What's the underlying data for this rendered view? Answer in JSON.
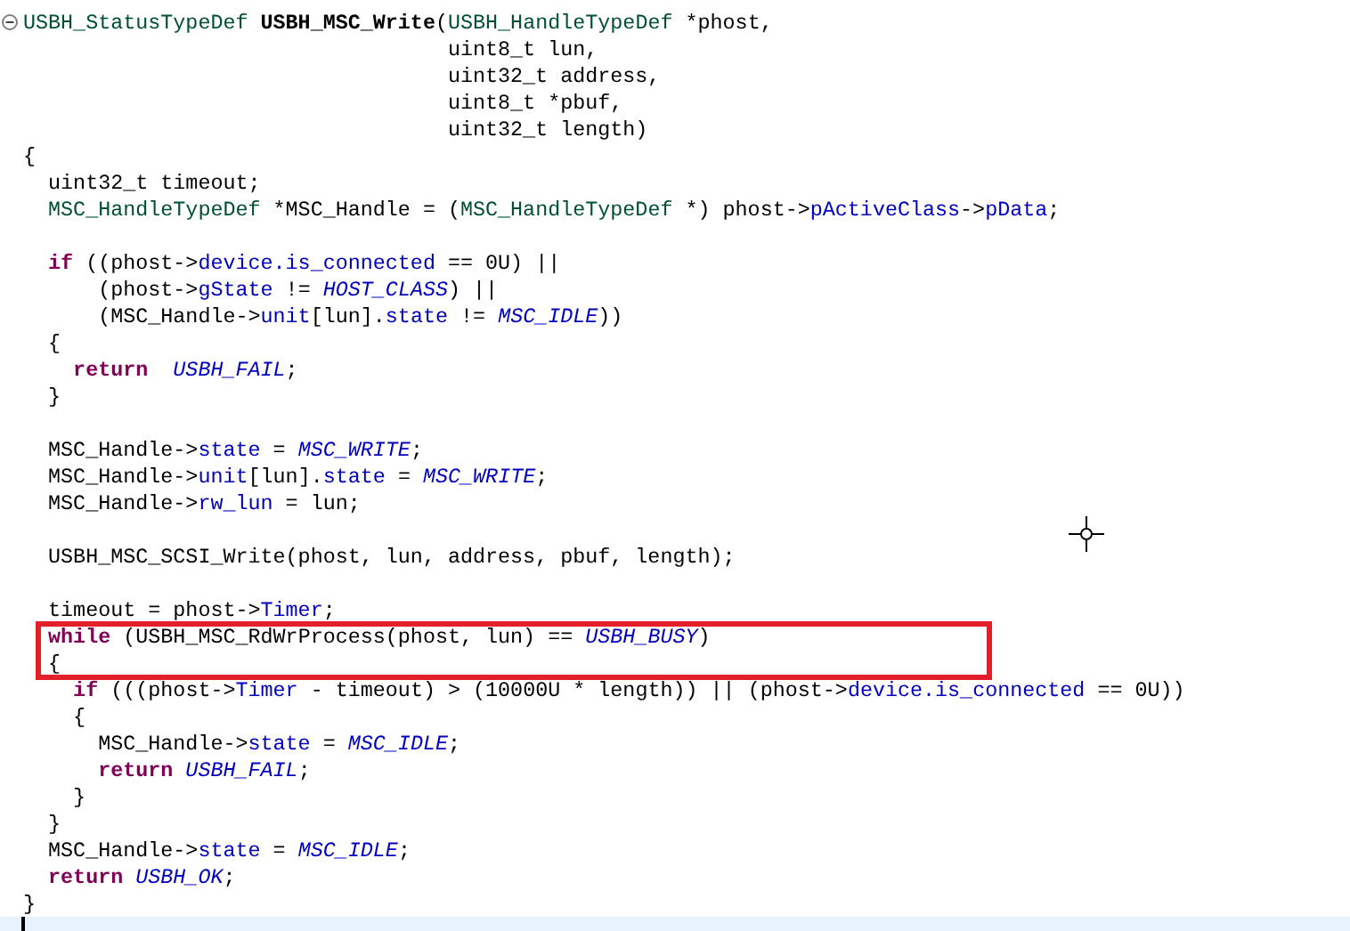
{
  "editor": {
    "lines": [
      {
        "kind": "code",
        "expanded": true,
        "tokens": [
          {
            "text": "USBH_StatusTypeDef ",
            "kind": "type"
          },
          {
            "text": "USBH_MSC_Write",
            "kind": "function"
          },
          {
            "text": "(",
            "kind": "plain"
          },
          {
            "text": "USBH_HandleTypeDef",
            "kind": "type"
          },
          {
            "text": " *phost,",
            "kind": "plain"
          }
        ]
      },
      {
        "kind": "code",
        "tokens": [
          {
            "text": "                                  uint8_t lun,",
            "kind": "plain"
          }
        ]
      },
      {
        "kind": "code",
        "tokens": [
          {
            "text": "                                  uint32_t address,",
            "kind": "plain"
          }
        ]
      },
      {
        "kind": "code",
        "tokens": [
          {
            "text": "                                  uint8_t *pbuf,",
            "kind": "plain"
          }
        ]
      },
      {
        "kind": "code",
        "tokens": [
          {
            "text": "                                  uint32_t length)",
            "kind": "plain"
          }
        ]
      },
      {
        "kind": "code",
        "tokens": [
          {
            "text": "{",
            "kind": "plain"
          }
        ]
      },
      {
        "kind": "code",
        "tokens": [
          {
            "text": "  uint32_t timeout;",
            "kind": "plain"
          }
        ]
      },
      {
        "kind": "code",
        "tokens": [
          {
            "text": "  MSC_HandleTypeDef",
            "kind": "type"
          },
          {
            "text": " *MSC_Handle = (",
            "kind": "plain"
          },
          {
            "text": "MSC_HandleTypeDef",
            "kind": "type"
          },
          {
            "text": " *) phost->",
            "kind": "plain"
          },
          {
            "text": "pActiveClass",
            "kind": "field"
          },
          {
            "text": "->",
            "kind": "plain"
          },
          {
            "text": "pData",
            "kind": "field"
          },
          {
            "text": ";",
            "kind": "plain"
          }
        ]
      },
      {
        "kind": "blank"
      },
      {
        "kind": "code",
        "tokens": [
          {
            "text": "  if",
            "kind": "keyword"
          },
          {
            "text": " ((phost->",
            "kind": "plain"
          },
          {
            "text": "device.is_connected",
            "kind": "field"
          },
          {
            "text": " == 0U) ||",
            "kind": "plain"
          }
        ]
      },
      {
        "kind": "code",
        "tokens": [
          {
            "text": "      (phost->",
            "kind": "plain"
          },
          {
            "text": "gState",
            "kind": "field"
          },
          {
            "text": " != ",
            "kind": "plain"
          },
          {
            "text": "HOST_CLASS",
            "kind": "constant"
          },
          {
            "text": ") ||",
            "kind": "plain"
          }
        ]
      },
      {
        "kind": "code",
        "tokens": [
          {
            "text": "      (MSC_Handle->",
            "kind": "plain"
          },
          {
            "text": "unit",
            "kind": "field"
          },
          {
            "text": "[lun].",
            "kind": "plain"
          },
          {
            "text": "state",
            "kind": "field"
          },
          {
            "text": " != ",
            "kind": "plain"
          },
          {
            "text": "MSC_IDLE",
            "kind": "constant"
          },
          {
            "text": "))",
            "kind": "plain"
          }
        ]
      },
      {
        "kind": "code",
        "tokens": [
          {
            "text": "  {",
            "kind": "plain"
          }
        ]
      },
      {
        "kind": "code",
        "tokens": [
          {
            "text": "    return",
            "kind": "keyword"
          },
          {
            "text": "  USBH_FAIL",
            "kind": "constant"
          },
          {
            "text": ";",
            "kind": "plain"
          }
        ]
      },
      {
        "kind": "code",
        "tokens": [
          {
            "text": "  }",
            "kind": "plain"
          }
        ]
      },
      {
        "kind": "blank"
      },
      {
        "kind": "code",
        "tokens": [
          {
            "text": "  MSC_Handle->",
            "kind": "plain"
          },
          {
            "text": "state",
            "kind": "field"
          },
          {
            "text": " = ",
            "kind": "plain"
          },
          {
            "text": "MSC_WRITE",
            "kind": "constant"
          },
          {
            "text": ";",
            "kind": "plain"
          }
        ]
      },
      {
        "kind": "code",
        "tokens": [
          {
            "text": "  MSC_Handle->",
            "kind": "plain"
          },
          {
            "text": "unit",
            "kind": "field"
          },
          {
            "text": "[lun].",
            "kind": "plain"
          },
          {
            "text": "state",
            "kind": "field"
          },
          {
            "text": " = ",
            "kind": "plain"
          },
          {
            "text": "MSC_WRITE",
            "kind": "constant"
          },
          {
            "text": ";",
            "kind": "plain"
          }
        ]
      },
      {
        "kind": "code",
        "tokens": [
          {
            "text": "  MSC_Handle->",
            "kind": "plain"
          },
          {
            "text": "rw_lun",
            "kind": "field"
          },
          {
            "text": " = lun;",
            "kind": "plain"
          }
        ]
      },
      {
        "kind": "blank"
      },
      {
        "kind": "code",
        "tokens": [
          {
            "text": "  USBH_MSC_SCSI_Write(phost, lun, address, pbuf, length);",
            "kind": "plain"
          }
        ]
      },
      {
        "kind": "blank"
      },
      {
        "kind": "code",
        "tokens": [
          {
            "text": "  timeout = phost->",
            "kind": "plain"
          },
          {
            "text": "Timer",
            "kind": "field"
          },
          {
            "text": ";",
            "kind": "plain"
          }
        ]
      },
      {
        "kind": "code",
        "boxed": true,
        "tokens": [
          {
            "text": "  while",
            "kind": "keyword"
          },
          {
            "text": " (USBH_MSC_RdWrProcess(phost, lun) == ",
            "kind": "plain"
          },
          {
            "text": "USBH_BUSY",
            "kind": "constant"
          },
          {
            "text": ")",
            "kind": "plain"
          }
        ]
      },
      {
        "kind": "code",
        "tokens": [
          {
            "text": "  {",
            "kind": "plain"
          }
        ]
      },
      {
        "kind": "code",
        "tokens": [
          {
            "text": "    if",
            "kind": "keyword"
          },
          {
            "text": " (((phost->",
            "kind": "plain"
          },
          {
            "text": "Timer",
            "kind": "field"
          },
          {
            "text": " - timeout) > (10000U * length)) || (phost->",
            "kind": "plain"
          },
          {
            "text": "device.is_connected",
            "kind": "field"
          },
          {
            "text": " == 0U))",
            "kind": "plain"
          }
        ]
      },
      {
        "kind": "code",
        "tokens": [
          {
            "text": "    {",
            "kind": "plain"
          }
        ]
      },
      {
        "kind": "code",
        "tokens": [
          {
            "text": "      MSC_Handle->",
            "kind": "plain"
          },
          {
            "text": "state",
            "kind": "field"
          },
          {
            "text": " = ",
            "kind": "plain"
          },
          {
            "text": "MSC_IDLE",
            "kind": "constant"
          },
          {
            "text": ";",
            "kind": "plain"
          }
        ]
      },
      {
        "kind": "code",
        "tokens": [
          {
            "text": "      return",
            "kind": "keyword"
          },
          {
            "text": " USBH_FAIL",
            "kind": "constant"
          },
          {
            "text": ";",
            "kind": "plain"
          }
        ]
      },
      {
        "kind": "code",
        "tokens": [
          {
            "text": "    }",
            "kind": "plain"
          }
        ]
      },
      {
        "kind": "code",
        "tokens": [
          {
            "text": "  }",
            "kind": "plain"
          }
        ]
      },
      {
        "kind": "code",
        "tokens": [
          {
            "text": "  MSC_Handle->",
            "kind": "plain"
          },
          {
            "text": "state",
            "kind": "field"
          },
          {
            "text": " = ",
            "kind": "plain"
          },
          {
            "text": "MSC_IDLE",
            "kind": "constant"
          },
          {
            "text": ";",
            "kind": "plain"
          }
        ]
      },
      {
        "kind": "code",
        "tokens": [
          {
            "text": "  return",
            "kind": "keyword"
          },
          {
            "text": " USBH_OK",
            "kind": "constant"
          },
          {
            "text": ";",
            "kind": "plain"
          }
        ]
      },
      {
        "kind": "code",
        "tokens": [
          {
            "text": "}",
            "kind": "plain"
          }
        ]
      },
      {
        "kind": "blank",
        "current": true
      }
    ]
  }
}
